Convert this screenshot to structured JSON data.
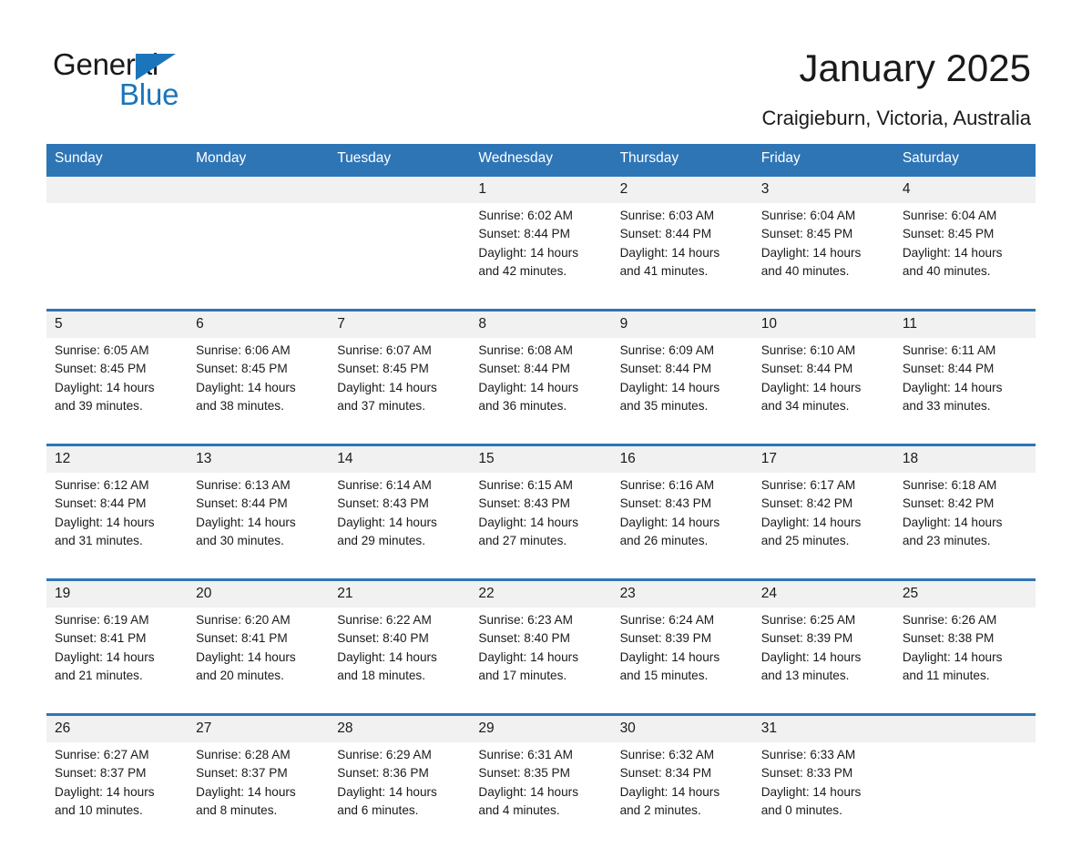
{
  "brand": {
    "name_part1": "General",
    "name_part2": "Blue",
    "triangle_color": "#1b75bb"
  },
  "header": {
    "title": "January 2025",
    "subtitle": "Craigieburn, Victoria, Australia"
  },
  "theme": {
    "header_blue": "#2e75b6",
    "daynum_band": "#f1f1f1",
    "text": "#1a1a1a"
  },
  "calendar": {
    "weekday_headers": [
      "Sunday",
      "Monday",
      "Tuesday",
      "Wednesday",
      "Thursday",
      "Friday",
      "Saturday"
    ],
    "weeks": [
      {
        "days": [
          {
            "num": "",
            "sunrise": "",
            "sunset": "",
            "daylight_line1": "",
            "daylight_line2": ""
          },
          {
            "num": "",
            "sunrise": "",
            "sunset": "",
            "daylight_line1": "",
            "daylight_line2": ""
          },
          {
            "num": "",
            "sunrise": "",
            "sunset": "",
            "daylight_line1": "",
            "daylight_line2": ""
          },
          {
            "num": "1",
            "sunrise": "Sunrise: 6:02 AM",
            "sunset": "Sunset: 8:44 PM",
            "daylight_line1": "Daylight: 14 hours",
            "daylight_line2": "and 42 minutes."
          },
          {
            "num": "2",
            "sunrise": "Sunrise: 6:03 AM",
            "sunset": "Sunset: 8:44 PM",
            "daylight_line1": "Daylight: 14 hours",
            "daylight_line2": "and 41 minutes."
          },
          {
            "num": "3",
            "sunrise": "Sunrise: 6:04 AM",
            "sunset": "Sunset: 8:45 PM",
            "daylight_line1": "Daylight: 14 hours",
            "daylight_line2": "and 40 minutes."
          },
          {
            "num": "4",
            "sunrise": "Sunrise: 6:04 AM",
            "sunset": "Sunset: 8:45 PM",
            "daylight_line1": "Daylight: 14 hours",
            "daylight_line2": "and 40 minutes."
          }
        ]
      },
      {
        "days": [
          {
            "num": "5",
            "sunrise": "Sunrise: 6:05 AM",
            "sunset": "Sunset: 8:45 PM",
            "daylight_line1": "Daylight: 14 hours",
            "daylight_line2": "and 39 minutes."
          },
          {
            "num": "6",
            "sunrise": "Sunrise: 6:06 AM",
            "sunset": "Sunset: 8:45 PM",
            "daylight_line1": "Daylight: 14 hours",
            "daylight_line2": "and 38 minutes."
          },
          {
            "num": "7",
            "sunrise": "Sunrise: 6:07 AM",
            "sunset": "Sunset: 8:45 PM",
            "daylight_line1": "Daylight: 14 hours",
            "daylight_line2": "and 37 minutes."
          },
          {
            "num": "8",
            "sunrise": "Sunrise: 6:08 AM",
            "sunset": "Sunset: 8:44 PM",
            "daylight_line1": "Daylight: 14 hours",
            "daylight_line2": "and 36 minutes."
          },
          {
            "num": "9",
            "sunrise": "Sunrise: 6:09 AM",
            "sunset": "Sunset: 8:44 PM",
            "daylight_line1": "Daylight: 14 hours",
            "daylight_line2": "and 35 minutes."
          },
          {
            "num": "10",
            "sunrise": "Sunrise: 6:10 AM",
            "sunset": "Sunset: 8:44 PM",
            "daylight_line1": "Daylight: 14 hours",
            "daylight_line2": "and 34 minutes."
          },
          {
            "num": "11",
            "sunrise": "Sunrise: 6:11 AM",
            "sunset": "Sunset: 8:44 PM",
            "daylight_line1": "Daylight: 14 hours",
            "daylight_line2": "and 33 minutes."
          }
        ]
      },
      {
        "days": [
          {
            "num": "12",
            "sunrise": "Sunrise: 6:12 AM",
            "sunset": "Sunset: 8:44 PM",
            "daylight_line1": "Daylight: 14 hours",
            "daylight_line2": "and 31 minutes."
          },
          {
            "num": "13",
            "sunrise": "Sunrise: 6:13 AM",
            "sunset": "Sunset: 8:44 PM",
            "daylight_line1": "Daylight: 14 hours",
            "daylight_line2": "and 30 minutes."
          },
          {
            "num": "14",
            "sunrise": "Sunrise: 6:14 AM",
            "sunset": "Sunset: 8:43 PM",
            "daylight_line1": "Daylight: 14 hours",
            "daylight_line2": "and 29 minutes."
          },
          {
            "num": "15",
            "sunrise": "Sunrise: 6:15 AM",
            "sunset": "Sunset: 8:43 PM",
            "daylight_line1": "Daylight: 14 hours",
            "daylight_line2": "and 27 minutes."
          },
          {
            "num": "16",
            "sunrise": "Sunrise: 6:16 AM",
            "sunset": "Sunset: 8:43 PM",
            "daylight_line1": "Daylight: 14 hours",
            "daylight_line2": "and 26 minutes."
          },
          {
            "num": "17",
            "sunrise": "Sunrise: 6:17 AM",
            "sunset": "Sunset: 8:42 PM",
            "daylight_line1": "Daylight: 14 hours",
            "daylight_line2": "and 25 minutes."
          },
          {
            "num": "18",
            "sunrise": "Sunrise: 6:18 AM",
            "sunset": "Sunset: 8:42 PM",
            "daylight_line1": "Daylight: 14 hours",
            "daylight_line2": "and 23 minutes."
          }
        ]
      },
      {
        "days": [
          {
            "num": "19",
            "sunrise": "Sunrise: 6:19 AM",
            "sunset": "Sunset: 8:41 PM",
            "daylight_line1": "Daylight: 14 hours",
            "daylight_line2": "and 21 minutes."
          },
          {
            "num": "20",
            "sunrise": "Sunrise: 6:20 AM",
            "sunset": "Sunset: 8:41 PM",
            "daylight_line1": "Daylight: 14 hours",
            "daylight_line2": "and 20 minutes."
          },
          {
            "num": "21",
            "sunrise": "Sunrise: 6:22 AM",
            "sunset": "Sunset: 8:40 PM",
            "daylight_line1": "Daylight: 14 hours",
            "daylight_line2": "and 18 minutes."
          },
          {
            "num": "22",
            "sunrise": "Sunrise: 6:23 AM",
            "sunset": "Sunset: 8:40 PM",
            "daylight_line1": "Daylight: 14 hours",
            "daylight_line2": "and 17 minutes."
          },
          {
            "num": "23",
            "sunrise": "Sunrise: 6:24 AM",
            "sunset": "Sunset: 8:39 PM",
            "daylight_line1": "Daylight: 14 hours",
            "daylight_line2": "and 15 minutes."
          },
          {
            "num": "24",
            "sunrise": "Sunrise: 6:25 AM",
            "sunset": "Sunset: 8:39 PM",
            "daylight_line1": "Daylight: 14 hours",
            "daylight_line2": "and 13 minutes."
          },
          {
            "num": "25",
            "sunrise": "Sunrise: 6:26 AM",
            "sunset": "Sunset: 8:38 PM",
            "daylight_line1": "Daylight: 14 hours",
            "daylight_line2": "and 11 minutes."
          }
        ]
      },
      {
        "days": [
          {
            "num": "26",
            "sunrise": "Sunrise: 6:27 AM",
            "sunset": "Sunset: 8:37 PM",
            "daylight_line1": "Daylight: 14 hours",
            "daylight_line2": "and 10 minutes."
          },
          {
            "num": "27",
            "sunrise": "Sunrise: 6:28 AM",
            "sunset": "Sunset: 8:37 PM",
            "daylight_line1": "Daylight: 14 hours",
            "daylight_line2": "and 8 minutes."
          },
          {
            "num": "28",
            "sunrise": "Sunrise: 6:29 AM",
            "sunset": "Sunset: 8:36 PM",
            "daylight_line1": "Daylight: 14 hours",
            "daylight_line2": "and 6 minutes."
          },
          {
            "num": "29",
            "sunrise": "Sunrise: 6:31 AM",
            "sunset": "Sunset: 8:35 PM",
            "daylight_line1": "Daylight: 14 hours",
            "daylight_line2": "and 4 minutes."
          },
          {
            "num": "30",
            "sunrise": "Sunrise: 6:32 AM",
            "sunset": "Sunset: 8:34 PM",
            "daylight_line1": "Daylight: 14 hours",
            "daylight_line2": "and 2 minutes."
          },
          {
            "num": "31",
            "sunrise": "Sunrise: 6:33 AM",
            "sunset": "Sunset: 8:33 PM",
            "daylight_line1": "Daylight: 14 hours",
            "daylight_line2": "and 0 minutes."
          },
          {
            "num": "",
            "sunrise": "",
            "sunset": "",
            "daylight_line1": "",
            "daylight_line2": ""
          }
        ]
      }
    ]
  }
}
